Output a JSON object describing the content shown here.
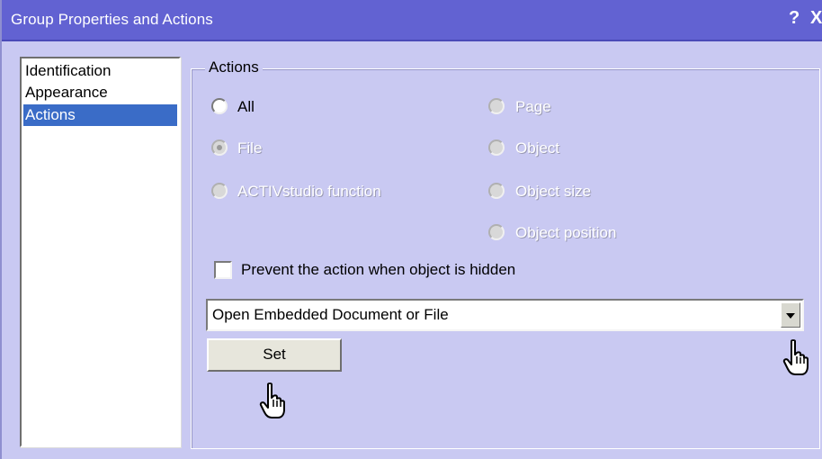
{
  "window": {
    "title": "Group Properties and Actions",
    "help_label": "?",
    "close_label": "X"
  },
  "nav": {
    "items": [
      {
        "label": "Identification",
        "selected": false
      },
      {
        "label": "Appearance",
        "selected": false
      },
      {
        "label": "Actions",
        "selected": true
      }
    ]
  },
  "actions_group": {
    "legend": "Actions",
    "radios": [
      {
        "label": "All",
        "checked": false,
        "enabled": true
      },
      {
        "label": "Page",
        "checked": false,
        "enabled": false
      },
      {
        "label": "File",
        "checked": true,
        "enabled": false
      },
      {
        "label": "Object",
        "checked": false,
        "enabled": false
      },
      {
        "label": "ACTIVstudio function",
        "checked": false,
        "enabled": false
      },
      {
        "label": "Object size",
        "checked": false,
        "enabled": false
      },
      {
        "label": "Object position",
        "checked": false,
        "enabled": false
      }
    ],
    "prevent_checkbox": {
      "label": "Prevent the action when object is hidden",
      "checked": false
    },
    "action_select": {
      "value": "Open Embedded Document or File"
    },
    "set_button": "Set"
  },
  "colors": {
    "title_bar": "#6262d2",
    "panel_background": "#c9c9f2",
    "selection": "#3a6cc7"
  },
  "icons": [
    "help-icon",
    "close-icon",
    "chevron-down-icon",
    "hand-pointer-icon"
  ]
}
